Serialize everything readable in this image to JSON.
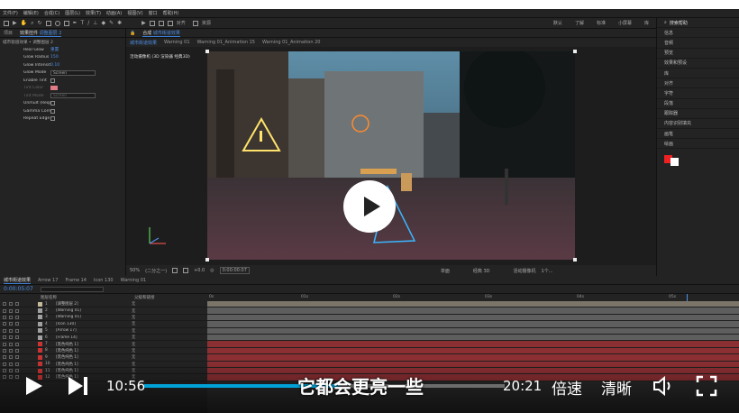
{
  "menu": [
    "文件(F)",
    "编辑(E)",
    "合成(C)",
    "图层(L)",
    "效果(T)",
    "动画(A)",
    "视图(V)",
    "窗口",
    "帮助(H)"
  ],
  "toolbar": {
    "snap_label": "对齐",
    "extra": "资源",
    "right_labels": [
      "默认",
      "了解",
      "标准",
      "小屏幕",
      "库"
    ],
    "search_label": "搜索帮助"
  },
  "effect_panel": {
    "tabs": [
      "项目",
      "效果控件",
      "调整图层 2"
    ],
    "title": "城市街道效果 • 调整图层 2",
    "rows": [
      {
        "name": "Real Glow",
        "value": "重置",
        "type": "head"
      },
      {
        "name": "Glow Radius",
        "value": "150",
        "type": "num"
      },
      {
        "name": "Glow Intensity",
        "value": "0.10",
        "type": "num"
      },
      {
        "name": "Glow Mode",
        "value": "Screen",
        "type": "dropdown"
      },
      {
        "name": "Enable Tint",
        "value": "",
        "type": "check"
      },
      {
        "name": "Tint Color",
        "value": "",
        "type": "swatch",
        "dim": true
      },
      {
        "name": "Tint Mode",
        "value": "Screen",
        "type": "dropdown",
        "dim": true
      },
      {
        "name": "Unmult (Required F",
        "value": "",
        "type": "check"
      },
      {
        "name": "Gamma Correction",
        "value": "",
        "type": "check"
      },
      {
        "name": "Repeat Edge Pixels",
        "value": "",
        "type": "check"
      }
    ]
  },
  "comp": {
    "tabs": [
      "合成",
      "城市街道效果"
    ],
    "breadcrumbs": [
      "城市街道效果",
      "Warning 01",
      "Warning 01_Animation 15",
      "Warning 01_Animation 20"
    ],
    "camera_label": "活动摄像机 (3D 渲染器 经典3D)",
    "footer": {
      "zoom": "50%",
      "res": "(二分之一)",
      "time": "0:00:00:07",
      "value": "+0.0",
      "view1": "单面",
      "view2": "经典 3D",
      "view3": "活动摄像机",
      "view4": "1个..."
    }
  },
  "right_panel": [
    "信息",
    "音频",
    "预览",
    "效果和预设",
    "库",
    "对齐",
    "字符",
    "段落",
    "跟踪器",
    "内容识别填充",
    "画笔",
    "绘画"
  ],
  "timeline": {
    "tabs": [
      "城市街道效果",
      "Arrow 17",
      "Frame 14",
      "Icon 130",
      "Warning 01"
    ],
    "current_time": "0:00:05:07",
    "header": {
      "source_name": "图层名称",
      "parent": "父级和链接"
    },
    "ruler": [
      "0s",
      "01s",
      "02s",
      "03s",
      "04s",
      "05s"
    ],
    "layers": [
      {
        "num": "1",
        "name": "[调整图层 2]",
        "parent": "无",
        "color": "#c4b998"
      },
      {
        "num": "2",
        "name": "[Warning 01]",
        "parent": "无",
        "color": "#a0a0a0"
      },
      {
        "num": "3",
        "name": "[Warning 01]",
        "parent": "无",
        "color": "#a0a0a0"
      },
      {
        "num": "4",
        "name": "[Icon 130]",
        "parent": "无",
        "color": "#a0a0a0"
      },
      {
        "num": "5",
        "name": "[Arrow 17]",
        "parent": "无",
        "color": "#a0a0a0"
      },
      {
        "num": "6",
        "name": "[Frame 14]",
        "parent": "无",
        "color": "#a0a0a0"
      },
      {
        "num": "7",
        "name": "[黑色纯色 1]",
        "parent": "无",
        "color": "#c83434"
      },
      {
        "num": "8",
        "name": "[黑色纯色 1]",
        "parent": "无",
        "color": "#c83434"
      },
      {
        "num": "9",
        "name": "[黑色纯色 1]",
        "parent": "无",
        "color": "#c83434"
      },
      {
        "num": "10",
        "name": "[黑色纯色 1]",
        "parent": "无",
        "color": "#c83434"
      },
      {
        "num": "11",
        "name": "[黑色纯色 1]",
        "parent": "无",
        "color": "#c83434"
      },
      {
        "num": "12",
        "name": "[黑色纯色 1]",
        "parent": "无",
        "color": "#c83434"
      }
    ]
  },
  "player": {
    "current": "10:56",
    "total": "20:21",
    "speed": "倍速",
    "quality": "清晰",
    "subtitle": "它都会更亮一些",
    "progress": 0.54
  }
}
